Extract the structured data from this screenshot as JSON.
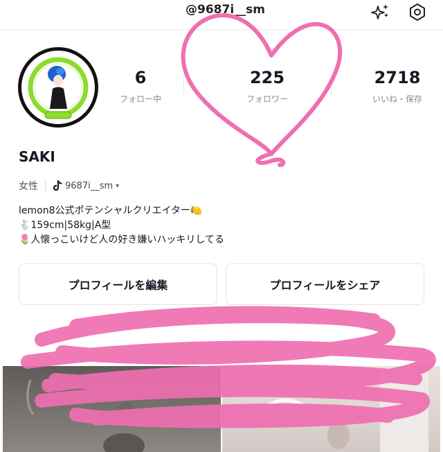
{
  "header": {
    "username": "@9687i__sm",
    "sparkle_icon": "sparkle-icon",
    "settings_icon": "settings-gear-icon"
  },
  "profile": {
    "avatar_icon": "avatar-illustration",
    "name": "SAKI",
    "gender": "女性",
    "handle": "9687i__sm",
    "bio": [
      "lemon8公式ポテンシャルクリエイター🍋",
      "🐇159cm|58kg|A型",
      "🌷人懐っこいけど人の好き嫌いハッキリしてる"
    ]
  },
  "stats": [
    {
      "value": "6",
      "label": "フォロー中"
    },
    {
      "value": "225",
      "label": "フォロワー"
    },
    {
      "value": "2718",
      "label": "いいね・保存"
    }
  ],
  "buttons": {
    "edit": "プロフィールを編集",
    "share": "プロフィールをシェア"
  },
  "colors": {
    "scribble": "#ef6fb0",
    "avatar_ring": "#8ddc2e",
    "text": "#161823",
    "muted": "#8a8b91"
  }
}
